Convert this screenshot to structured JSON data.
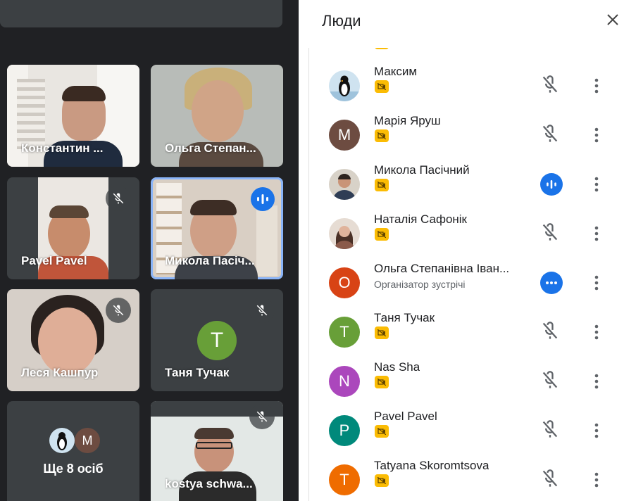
{
  "grid": {
    "more_people_label": "Ще 8 осіб",
    "more_avatar_letter": "M",
    "tiles": [
      {
        "name": "Константин ..."
      },
      {
        "name": "Ольга Степан..."
      },
      {
        "name": "Pavel Pavel"
      },
      {
        "name": "Микола Пасіч..."
      },
      {
        "name": "Леся Кашпур"
      },
      {
        "name": "Таня Тучак",
        "avatar_letter": "T"
      },
      {
        "name": "kostya schwa..."
      }
    ]
  },
  "panel": {
    "title": "Люди",
    "participants": [
      {
        "name": "Максим",
        "avatar": "penguin-photo",
        "mic": "muted"
      },
      {
        "name": "Марія Яруш",
        "avatar_letter": "M",
        "color": "#6d4c41",
        "mic": "muted"
      },
      {
        "name": "Микола Пасічний",
        "avatar": "photo",
        "mic": "speaking"
      },
      {
        "name": "Наталія Сафонік",
        "avatar": "photo",
        "mic": "muted"
      },
      {
        "name": "Ольга Степанівна Іван...",
        "avatar_letter": "О",
        "color": "#d84315",
        "subtitle": "Організатор зустрічі",
        "mic": "more"
      },
      {
        "name": "Таня Тучак",
        "avatar_letter": "T",
        "color": "#689f38",
        "mic": "muted"
      },
      {
        "name": "Nas Sha",
        "avatar_letter": "N",
        "color": "#ab47bc",
        "mic": "muted"
      },
      {
        "name": "Pavel Pavel",
        "avatar_letter": "P",
        "color": "#00897b",
        "mic": "muted"
      },
      {
        "name": "Tatyana Skoromtsova",
        "avatar_letter": "T",
        "color": "#ef6c00",
        "mic": "muted"
      }
    ]
  }
}
